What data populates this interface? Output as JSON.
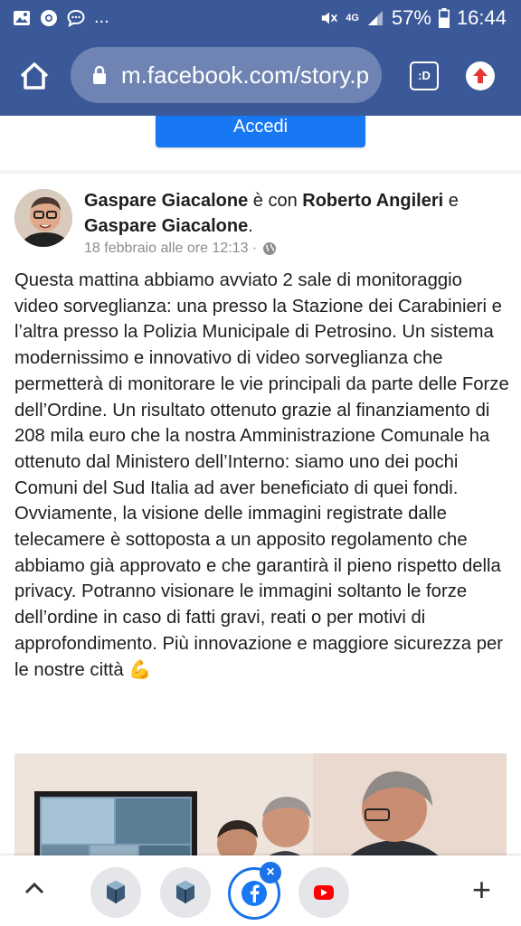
{
  "status_bar": {
    "notif_dots": "...",
    "network": "4G",
    "battery_pct": "57%",
    "time": "16:44"
  },
  "browser": {
    "url": "m.facebook.com/story.p",
    "tab_label": ":D"
  },
  "login_button_label": "Accedi",
  "post": {
    "author": "Gaspare Giacalone",
    "with_text": " è con ",
    "tagged_1": "Roberto Angileri",
    "and_text": " e ",
    "tagged_2": "Gaspare Giacalone",
    "period": ".",
    "date": "18 febbraio alle ore 12:13 ·",
    "body": "Questa mattina abbiamo avviato 2 sale di monitoraggio video sorveglianza: una presso la Stazione dei Carabinieri e l’altra presso la Polizia Municipale di Petrosino. Un sistema modernissimo e innovativo di video sorveglianza che permetterà di monitorare le vie principali da parte delle Forze dell’Ordine. Un risultato ottenuto grazie al finanziamento di 208 mila euro che la nostra Amministrazione Comunale ha ottenuto dal Ministero dell’Interno: siamo uno dei pochi Comuni del Sud Italia ad aver beneficiato di quei fondi. Ovviamente, la visione delle immagini registrate dalle telecamere è sottoposta a un apposito regolamento che abbiamo già approvato e che garantirà il pieno rispetto della privacy. Potranno visionare le immagini soltanto le forze dell’ordine in caso di fatti gravi, reati o per motivi di approfondimento. Più innovazione e maggiore sicurezza per le nostre città 💪"
  },
  "bottom_bar": {
    "badge": "×",
    "plus": "+"
  },
  "colors": {
    "facebook_blue": "#3b5998",
    "accent": "#1877f2"
  }
}
